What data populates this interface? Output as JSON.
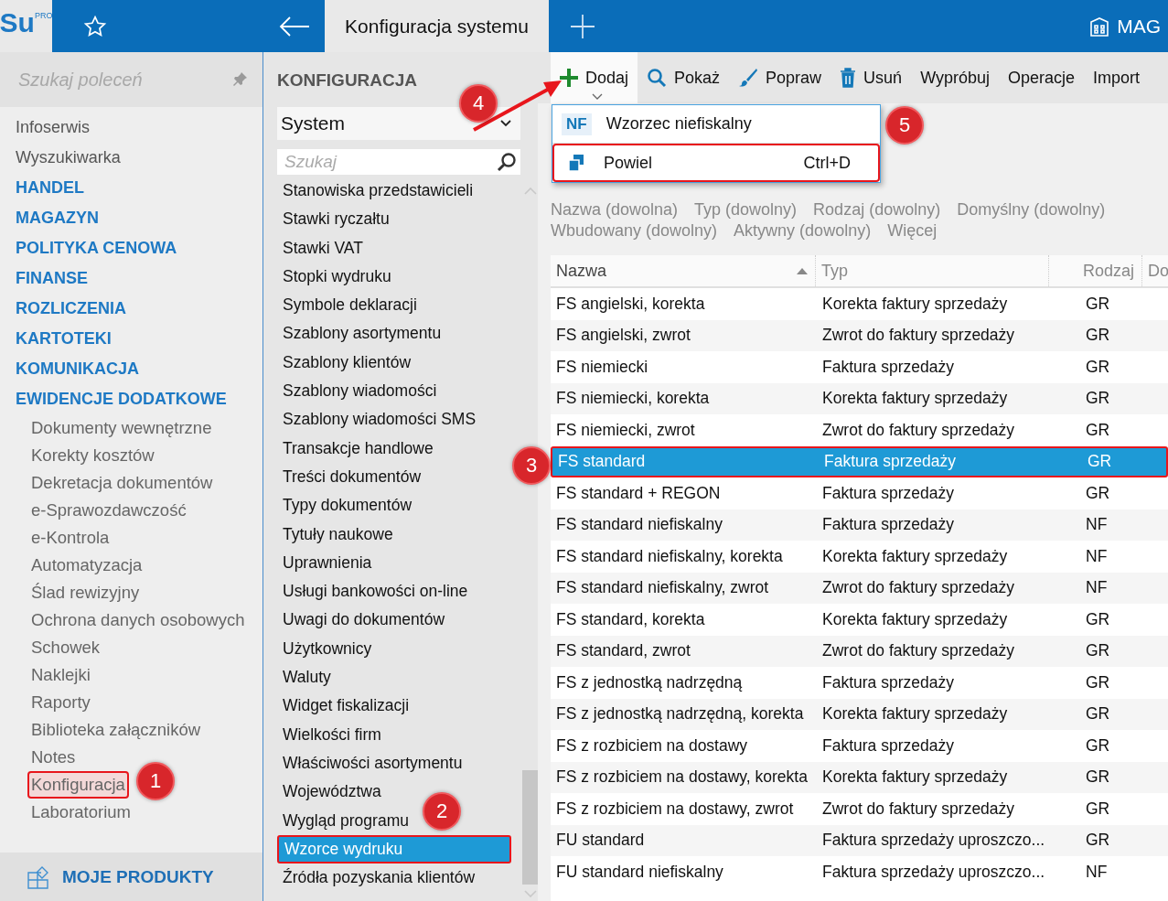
{
  "logo": {
    "text": "Su",
    "badge": "PRO"
  },
  "top_bar": {
    "tab_title": "Konfiguracja systemu",
    "company": "MAG"
  },
  "sidebar": {
    "search_placeholder": "Szukaj poleceń",
    "items": [
      {
        "label": "Infoserwis",
        "kind": "link"
      },
      {
        "label": "Wyszukiwarka",
        "kind": "link"
      },
      {
        "label": "HANDEL",
        "kind": "section"
      },
      {
        "label": "MAGAZYN",
        "kind": "section"
      },
      {
        "label": "POLITYKA CENOWA",
        "kind": "section"
      },
      {
        "label": "FINANSE",
        "kind": "section"
      },
      {
        "label": "ROZLICZENIA",
        "kind": "section"
      },
      {
        "label": "KARTOTEKI",
        "kind": "section"
      },
      {
        "label": "KOMUNIKACJA",
        "kind": "section"
      },
      {
        "label": "EWIDENCJE DODATKOWE",
        "kind": "section",
        "children": [
          {
            "label": "Dokumenty wewnętrzne",
            "highlighted": false
          },
          {
            "label": "Korekty kosztów",
            "highlighted": false
          },
          {
            "label": "Dekretacja dokumentów",
            "highlighted": false
          },
          {
            "label": "e-Sprawozdawczość",
            "highlighted": false
          },
          {
            "label": "e-Kontrola",
            "highlighted": false
          },
          {
            "label": "Automatyzacja",
            "highlighted": false
          },
          {
            "label": "Ślad rewizyjny",
            "highlighted": false
          },
          {
            "label": "Ochrona danych osobowych",
            "highlighted": false
          },
          {
            "label": "Schowek",
            "highlighted": false
          },
          {
            "label": "Naklejki",
            "highlighted": false
          },
          {
            "label": "Raporty",
            "highlighted": false
          },
          {
            "label": "Biblioteka załączników",
            "highlighted": false
          },
          {
            "label": "Notes",
            "highlighted": false
          },
          {
            "label": "Konfiguracja",
            "highlighted": true
          },
          {
            "label": "Laboratorium",
            "highlighted": false
          }
        ]
      }
    ],
    "footer": "MOJE PRODUKTY"
  },
  "config_panel": {
    "heading": "KONFIGURACJA",
    "dropdown_value": "System",
    "search_placeholder": "Szukaj",
    "items": [
      {
        "label": "Stanowiska przedstawicieli",
        "selected": false
      },
      {
        "label": "Stawki ryczałtu",
        "selected": false
      },
      {
        "label": "Stawki VAT",
        "selected": false
      },
      {
        "label": "Stopki wydruku",
        "selected": false
      },
      {
        "label": "Symbole deklaracji",
        "selected": false
      },
      {
        "label": "Szablony asortymentu",
        "selected": false
      },
      {
        "label": "Szablony klientów",
        "selected": false
      },
      {
        "label": "Szablony wiadomości",
        "selected": false
      },
      {
        "label": "Szablony wiadomości SMS",
        "selected": false
      },
      {
        "label": "Transakcje handlowe",
        "selected": false
      },
      {
        "label": "Treści dokumentów",
        "selected": false
      },
      {
        "label": "Typy dokumentów",
        "selected": false
      },
      {
        "label": "Tytuły naukowe",
        "selected": false
      },
      {
        "label": "Uprawnienia",
        "selected": false
      },
      {
        "label": "Usługi bankowości on-line",
        "selected": false
      },
      {
        "label": "Uwagi do dokumentów",
        "selected": false
      },
      {
        "label": "Użytkownicy",
        "selected": false
      },
      {
        "label": "Waluty",
        "selected": false
      },
      {
        "label": "Widget fiskalizacji",
        "selected": false
      },
      {
        "label": "Wielkości firm",
        "selected": false
      },
      {
        "label": "Właściwości asortymentu",
        "selected": false
      },
      {
        "label": "Województwa",
        "selected": false
      },
      {
        "label": "Wygląd programu",
        "selected": false
      },
      {
        "label": "Wzorce wydruku",
        "selected": true
      },
      {
        "label": "Źródła pozyskania klientów",
        "selected": false
      }
    ]
  },
  "toolbar": [
    {
      "label": "Dodaj",
      "kind": "add",
      "expanded": true
    },
    {
      "label": "Pokaż",
      "kind": "view",
      "expanded": false
    },
    {
      "label": "Popraw",
      "kind": "edit",
      "expanded": false
    },
    {
      "label": "Usuń",
      "kind": "delete",
      "expanded": false
    },
    {
      "label": "Wypróbuj",
      "kind": "text",
      "expanded": false
    },
    {
      "label": "Operacje",
      "kind": "text",
      "expanded": false
    },
    {
      "label": "Import",
      "kind": "text",
      "expanded": false
    }
  ],
  "add_menu": [
    {
      "label": "Wzorzec niefiskalny",
      "kind": "badge",
      "badge": "NF",
      "highlighted": false
    },
    {
      "label": "Powiel",
      "kind": "icon",
      "shortcut": "Ctrl+D",
      "highlighted": true
    }
  ],
  "filters": [
    "Nazwa (dowolna)",
    "Typ (dowolny)",
    "Rodzaj (dowolny)",
    "Domyślny (dowolny)",
    "Wbudowany (dowolny)",
    "Aktywny (dowolny)",
    "Więcej"
  ],
  "table": {
    "columns": [
      {
        "label": "Nazwa",
        "sorted": true
      },
      {
        "label": "Typ",
        "sorted": false
      },
      {
        "label": "Rodzaj",
        "sorted": false
      },
      {
        "label": "Do",
        "sorted": false
      }
    ],
    "rows": [
      {
        "name": "FS angielski, korekta",
        "type": "Korekta faktury sprzedaży",
        "kind": "GR",
        "selected": false
      },
      {
        "name": "FS angielski, zwrot",
        "type": "Zwrot do faktury sprzedaży",
        "kind": "GR",
        "selected": false
      },
      {
        "name": "FS niemiecki",
        "type": "Faktura sprzedaży",
        "kind": "GR",
        "selected": false
      },
      {
        "name": "FS niemiecki, korekta",
        "type": "Korekta faktury sprzedaży",
        "kind": "GR",
        "selected": false
      },
      {
        "name": "FS niemiecki, zwrot",
        "type": "Zwrot do faktury sprzedaży",
        "kind": "GR",
        "selected": false
      },
      {
        "name": "FS standard",
        "type": "Faktura sprzedaży",
        "kind": "GR",
        "selected": true
      },
      {
        "name": "FS standard + REGON",
        "type": "Faktura sprzedaży",
        "kind": "GR",
        "selected": false
      },
      {
        "name": "FS standard niefiskalny",
        "type": "Faktura sprzedaży",
        "kind": "NF",
        "selected": false
      },
      {
        "name": "FS standard niefiskalny, korekta",
        "type": "Korekta faktury sprzedaży",
        "kind": "NF",
        "selected": false
      },
      {
        "name": "FS standard niefiskalny, zwrot",
        "type": "Zwrot do faktury sprzedaży",
        "kind": "NF",
        "selected": false
      },
      {
        "name": "FS standard, korekta",
        "type": "Korekta faktury sprzedaży",
        "kind": "GR",
        "selected": false
      },
      {
        "name": "FS standard, zwrot",
        "type": "Zwrot do faktury sprzedaży",
        "kind": "GR",
        "selected": false
      },
      {
        "name": "FS z jednostką nadrzędną",
        "type": "Faktura sprzedaży",
        "kind": "GR",
        "selected": false
      },
      {
        "name": "FS z jednostką nadrzędną, korekta",
        "type": "Korekta faktury sprzedaży",
        "kind": "GR",
        "selected": false
      },
      {
        "name": "FS z rozbiciem na dostawy",
        "type": "Faktura sprzedaży",
        "kind": "GR",
        "selected": false
      },
      {
        "name": "FS z rozbiciem na dostawy, korekta",
        "type": "Korekta faktury sprzedaży",
        "kind": "GR",
        "selected": false
      },
      {
        "name": "FS z rozbiciem na dostawy, zwrot",
        "type": "Zwrot do faktury sprzedaży",
        "kind": "GR",
        "selected": false
      },
      {
        "name": "FU standard",
        "type": "Faktura sprzedaży uproszczo...",
        "kind": "GR",
        "selected": false
      },
      {
        "name": "FU standard niefiskalny",
        "type": "Faktura sprzedaży uproszczo...",
        "kind": "NF",
        "selected": false
      }
    ]
  },
  "annotations": [
    "1",
    "2",
    "3",
    "4",
    "5"
  ]
}
